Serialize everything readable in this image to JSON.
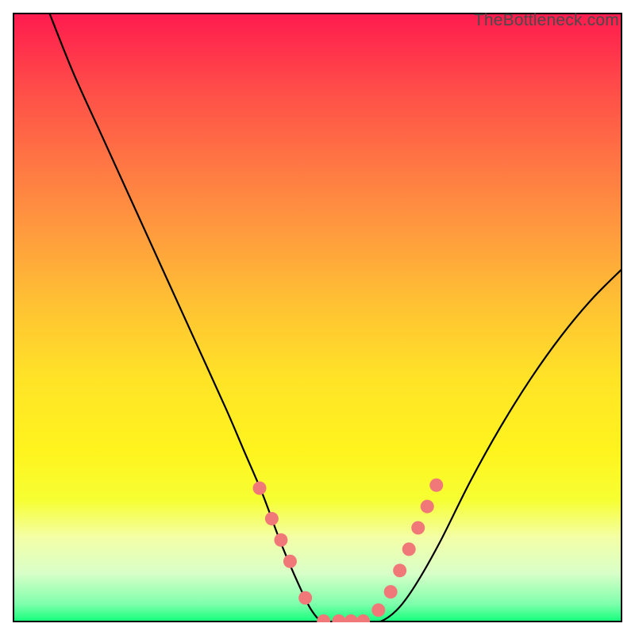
{
  "watermark": "TheBottleneck.com",
  "chart_data": {
    "type": "line",
    "title": "",
    "xlabel": "",
    "ylabel": "",
    "xlim": [
      0,
      100
    ],
    "ylim": [
      0,
      100
    ],
    "annotations": [],
    "gradient_bands": [
      {
        "color": "#ff1a4e",
        "stop": 0
      },
      {
        "color": "#ff4b49",
        "stop": 12
      },
      {
        "color": "#ff7444",
        "stop": 24
      },
      {
        "color": "#ff9b3e",
        "stop": 36
      },
      {
        "color": "#ffc233",
        "stop": 48
      },
      {
        "color": "#ffe327",
        "stop": 60
      },
      {
        "color": "#fff41e",
        "stop": 72
      },
      {
        "color": "#f6ff33",
        "stop": 80
      },
      {
        "color": "#f4ffa6",
        "stop": 86
      },
      {
        "color": "#d8ffc8",
        "stop": 92
      },
      {
        "color": "#7effab",
        "stop": 97
      },
      {
        "color": "#0fff7a",
        "stop": 100
      }
    ],
    "series": [
      {
        "name": "bottleneck-curve",
        "x": [
          6,
          10,
          15,
          20,
          25,
          30,
          35,
          38,
          41,
          44,
          47,
          49,
          51,
          54,
          57,
          60,
          63,
          66,
          70,
          75,
          80,
          85,
          90,
          95,
          100
        ],
        "y": [
          100,
          90,
          79,
          68,
          57,
          46,
          35,
          28,
          21,
          13,
          6,
          2,
          0,
          0,
          0,
          0,
          2,
          6,
          13,
          23,
          32,
          40,
          47,
          53,
          58
        ]
      }
    ],
    "points": {
      "name": "highlight-dots",
      "color": "#f07878",
      "x": [
        40.5,
        42.5,
        44.0,
        45.5,
        48.0,
        51.0,
        53.5,
        55.5,
        57.5,
        60.0,
        62.0,
        63.5,
        65.0,
        66.5,
        68.0,
        69.5
      ],
      "y": [
        22,
        17,
        13.5,
        10,
        4,
        0.2,
        0.2,
        0.2,
        0.2,
        2,
        5,
        8.5,
        12,
        15.5,
        19,
        22.5
      ]
    }
  }
}
